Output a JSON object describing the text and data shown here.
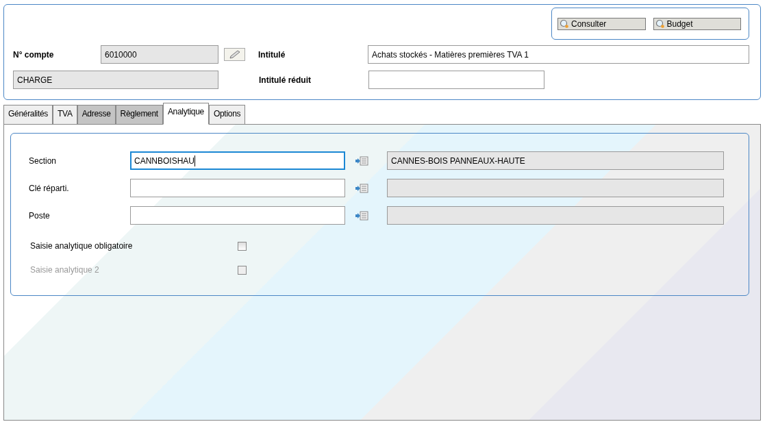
{
  "toolbar": {
    "buttons": [
      "Consulter",
      "Budget"
    ]
  },
  "header": {
    "account_label": "N° compte",
    "account_value": "6010000",
    "type_value": "CHARGE",
    "title_label": "Intitulé",
    "title_value": "Achats stockés - Matières premières TVA 1",
    "short_title_label": "Intitulé réduit"
  },
  "tabs": [
    {
      "label": "Généralités",
      "selected": false,
      "disabled": false
    },
    {
      "label": "TVA",
      "selected": false,
      "disabled": false
    },
    {
      "label": "Adresse",
      "selected": false,
      "disabled": true
    },
    {
      "label": "Règlement",
      "selected": false,
      "disabled": true
    },
    {
      "label": "Analytique",
      "selected": true,
      "disabled": false
    },
    {
      "label": "Options",
      "selected": false,
      "disabled": false
    }
  ],
  "analytic_fields": [
    {
      "label": "Section",
      "value": "CANNBOISHAU",
      "focused": true,
      "description": "CANNES-BOIS PANNEAUX-HAUTE"
    },
    {
      "label": "Clé réparti.",
      "focused": false
    },
    {
      "label": "Poste",
      "focused": false
    }
  ],
  "options": [
    {
      "label": "Saisie analytique obligatoire",
      "checked": false,
      "disabled": false
    },
    {
      "label": "Saisie analytique 2",
      "checked": false,
      "disabled": true
    }
  ]
}
